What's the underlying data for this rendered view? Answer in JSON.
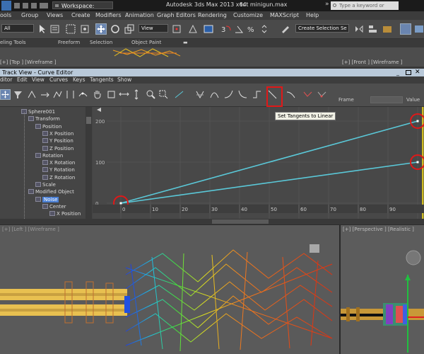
{
  "titlebar": {
    "workspace": "Workspace: Default",
    "app_title": "Autodesk 3ds Max  2013 x64",
    "file_name": "tut minigun.max",
    "search_placeholder": "Type a keyword or phrase"
  },
  "menubar": {
    "items": [
      "ools",
      "Group",
      "Views",
      "Create",
      "Modifiers",
      "Animation",
      "Graph Editors",
      "Rendering",
      "Customize",
      "MAXScript",
      "Help"
    ]
  },
  "maintoolbar": {
    "selection_filter": "All",
    "ref_coord": "View",
    "selection_set": "Create Selection Se"
  },
  "ribbon": {
    "tabs": [
      "eling Tools",
      "Freeform",
      "Selection",
      "Object Paint"
    ]
  },
  "viewports_top": {
    "left_label": "[+] [Top ] [Wireframe ]",
    "right_label": "[+] [Front ] [Wireframe ]"
  },
  "trackview": {
    "title": "Track View - Curve Editor",
    "menu": [
      "ditor",
      "Edit",
      "View",
      "Curves",
      "Keys",
      "Tangents",
      "Show"
    ],
    "frame_label": "Frame",
    "value_label": "Value",
    "tooltip": "Set Tangents to Linear",
    "tree": [
      {
        "label": "Sphere001",
        "depth": 0
      },
      {
        "label": "Transform",
        "depth": 1
      },
      {
        "label": "Position",
        "depth": 2
      },
      {
        "label": "X Position",
        "depth": 3
      },
      {
        "label": "Y Position",
        "depth": 3
      },
      {
        "label": "Z Position",
        "depth": 3
      },
      {
        "label": "Rotation",
        "depth": 2
      },
      {
        "label": "X Rotation",
        "depth": 3
      },
      {
        "label": "Y Rotation",
        "depth": 3
      },
      {
        "label": "Z Rotation",
        "depth": 3
      },
      {
        "label": "Scale",
        "depth": 2
      },
      {
        "label": "Modified Object",
        "depth": 1
      },
      {
        "label": "Noise",
        "depth": 2
      },
      {
        "label": "Center",
        "depth": 3
      },
      {
        "label": "X Position",
        "depth": 4
      }
    ],
    "y_ticks": [
      "200",
      "100",
      "0"
    ],
    "x_ticks": [
      "0",
      "10",
      "20",
      "30",
      "40",
      "50",
      "60",
      "70",
      "80",
      "90"
    ]
  },
  "viewports_bottom": {
    "left_label": "[+] [Left ] [Wireframe ]",
    "right_label": "[+] [Perspective ] [Realistic ]"
  },
  "colors": {
    "curve": "#5ac8d8",
    "highlight": "#e01818",
    "frame_marker": "#e8d21c",
    "selection": "#4a7fd4"
  }
}
